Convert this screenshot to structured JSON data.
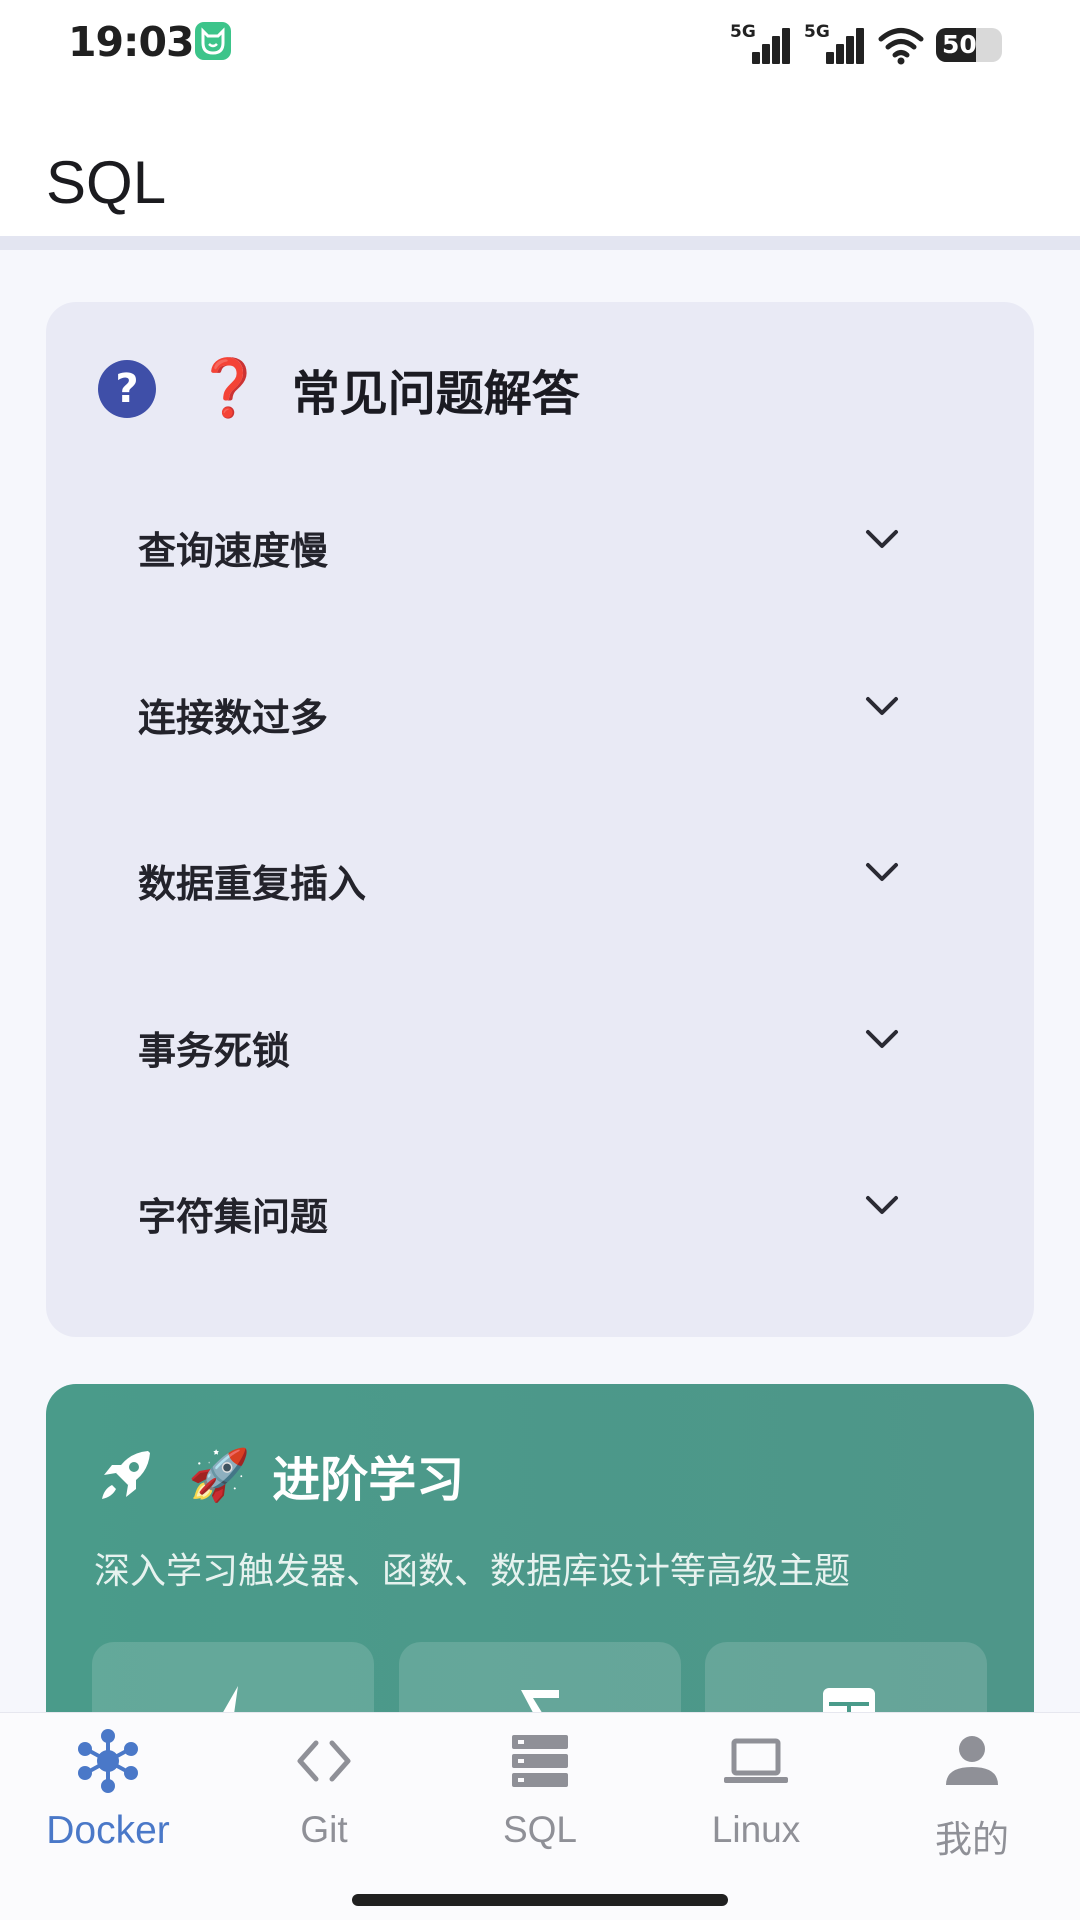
{
  "status_bar": {
    "time": "19:03",
    "signal1_label": "5G",
    "signal2_label": "5G",
    "battery": "50"
  },
  "app_bar": {
    "title": "SQL"
  },
  "faq": {
    "title": "常见问题解答",
    "emoji": "❓",
    "items": [
      {
        "label": "查询速度慢"
      },
      {
        "label": "连接数过多"
      },
      {
        "label": "数据重复插入"
      },
      {
        "label": "事务死锁"
      },
      {
        "label": "字符集问题"
      }
    ]
  },
  "advanced": {
    "emoji": "🚀",
    "title": "进阶学习",
    "description": "深入学习触发器、函数、数据库设计等高级主题"
  },
  "nav": {
    "items": [
      {
        "label": "Docker"
      },
      {
        "label": "Git"
      },
      {
        "label": "SQL"
      },
      {
        "label": "Linux"
      },
      {
        "label": "我的"
      }
    ]
  },
  "colors": {
    "accent": "#4a78c8",
    "faq_card": "#e9eaf5",
    "advanced_card": "#4a9b8a"
  }
}
